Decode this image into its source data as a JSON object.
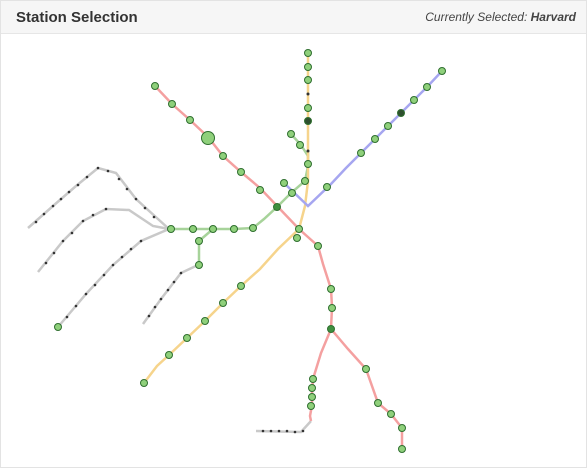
{
  "header": {
    "title": "Station Selection",
    "selected_label": "Currently Selected:",
    "selected_value": "Harvard"
  },
  "colors": {
    "red_line": "#f4a0a0",
    "orange_line": "#f6d48c",
    "green_line": "#a7d39a",
    "blue_line": "#a6a6f0",
    "silver_line": "#c9c9c9",
    "station_fill": "#8fd07b",
    "station_stroke": "#2f6f2f",
    "selected_station_fill": "#3f8f3f"
  }
}
